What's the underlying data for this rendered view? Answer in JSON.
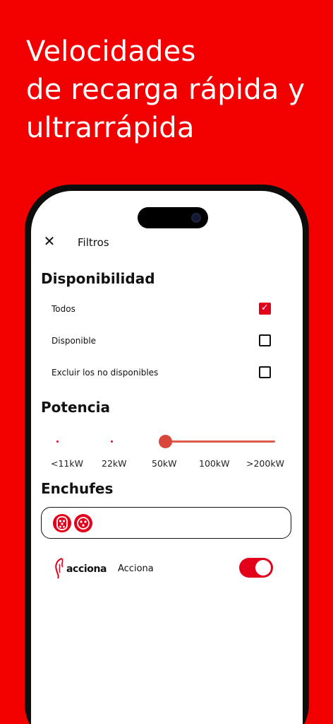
{
  "headline": [
    "Velocidades",
    "de recarga rápida y",
    "ultrarrápida"
  ],
  "header": {
    "close_icon": "close-icon",
    "title": "Filtros"
  },
  "availability": {
    "title": "Disponibilidad",
    "options": [
      {
        "label": "Todos",
        "checked": true
      },
      {
        "label": "Disponible",
        "checked": false
      },
      {
        "label": "Excluir los no disponibles",
        "checked": false
      }
    ]
  },
  "power": {
    "title": "Potencia",
    "ticks": [
      "<11kW",
      "22kW",
      "50kW",
      "100kW",
      ">200kW"
    ],
    "selected_min": "50kW",
    "selected_max": ">200kW"
  },
  "plugs": {
    "title": "Enchufes",
    "items": [
      "plug-type2-icon",
      "plug-ccs-icon"
    ]
  },
  "operator": {
    "logo_text": "acciona",
    "label": "Acciona",
    "enabled": true
  },
  "colors": {
    "brand_red": "#f20000",
    "accent": "#e3001b"
  }
}
